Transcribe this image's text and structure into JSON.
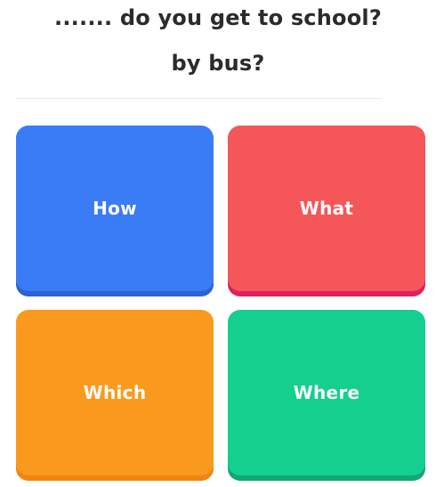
{
  "question": {
    "line1": "....... do you get to school?",
    "line2": "by bus?"
  },
  "options": [
    {
      "label": "How",
      "color": "#3a7bf6",
      "shadow": "#2f62d1"
    },
    {
      "label": "What",
      "color": "#f5565a",
      "shadow": "#e0205e"
    },
    {
      "label": "Which",
      "color": "#f99a1e",
      "shadow": "#f08512"
    },
    {
      "label": "Where",
      "color": "#14cf8d",
      "shadow": "#10a776"
    }
  ]
}
